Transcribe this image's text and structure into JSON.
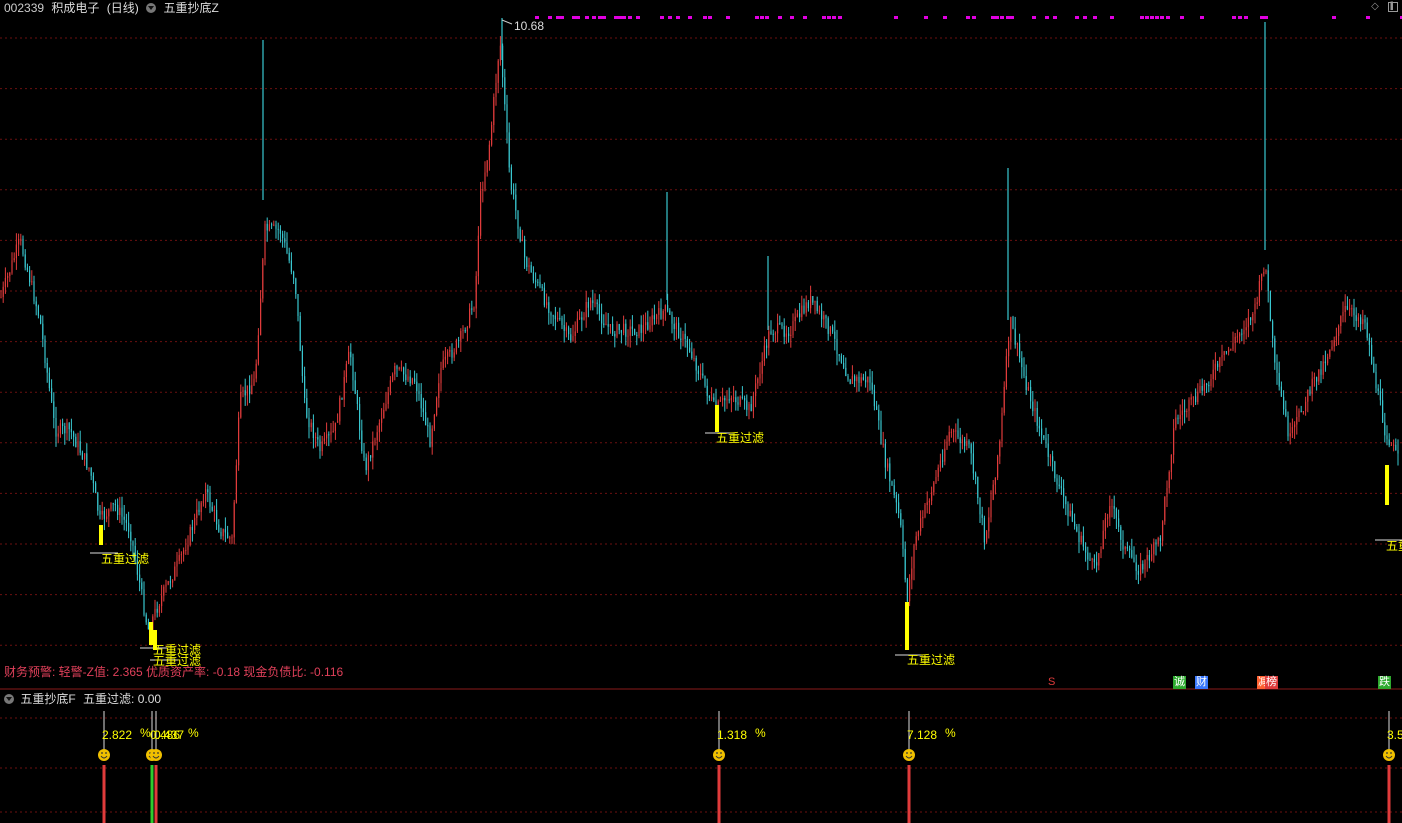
{
  "header": {
    "code": "002339",
    "name": "积成电子",
    "period": "(日线)",
    "indicator": "五重抄底Z"
  },
  "colors": {
    "up": "#e03b3b",
    "down": "#39c7d0",
    "signal": "#ffff00",
    "marker": "#e000e0",
    "grid": "#6b1010",
    "finance": "#e0405a"
  },
  "main_chart": {
    "high_label": "10.68",
    "signal_label": "五重过滤",
    "finance_text": "财务预警: 轻警-Z值: 2.365 优质资产率: -0.18 现金负债比: -0.116"
  },
  "badges": [
    {
      "text": "S",
      "color": "#e03b3b"
    },
    {
      "text": "诚",
      "color": "#2eaa2e"
    },
    {
      "text": "财",
      "color": "#3a78ff"
    },
    {
      "text": "减",
      "color": "#ff6030"
    },
    {
      "text": "榜",
      "color": "#e03b3b"
    },
    {
      "text": "跌",
      "color": "#2eaa2e"
    }
  ],
  "sub_chart": {
    "title": "五重抄底F",
    "value_text": "五重过滤: 0.00",
    "pct_symbol": "%",
    "labels": [
      "2.822",
      "0.486",
      "0.437",
      "1.318",
      "7.128",
      "3.5"
    ]
  }
}
